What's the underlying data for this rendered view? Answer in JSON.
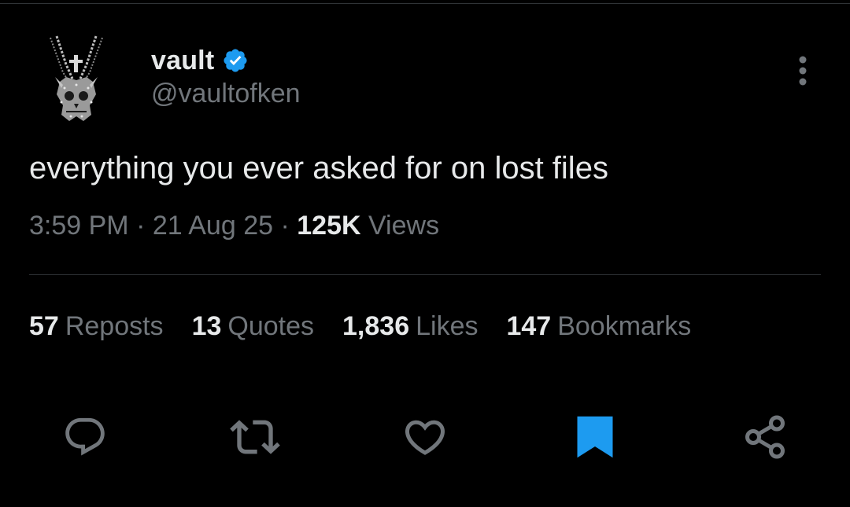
{
  "author": {
    "display_name": "vault",
    "handle": "@vaultofken",
    "verified_icon": "verified-badge-icon"
  },
  "tweet": {
    "text": "everything you ever asked for on lost files"
  },
  "meta": {
    "time": "3:59 PM",
    "separator_1": "·",
    "date": "21 Aug 25",
    "separator_2": "·",
    "views_count": "125K",
    "views_label": "Views"
  },
  "stats": [
    {
      "count": "57",
      "label": "Reposts"
    },
    {
      "count": "13",
      "label": "Quotes"
    },
    {
      "count": "1,836",
      "label": "Likes"
    },
    {
      "count": "147",
      "label": "Bookmarks"
    }
  ],
  "actions": [
    {
      "icon": "reply-icon"
    },
    {
      "icon": "repost-icon"
    },
    {
      "icon": "like-icon"
    },
    {
      "icon": "bookmark-icon",
      "active": true
    },
    {
      "icon": "share-icon"
    }
  ],
  "colors": {
    "background": "#000000",
    "text_primary": "#e7e9ea",
    "text_secondary": "#71767b",
    "accent": "#1d9bf0",
    "divider": "#2f3336"
  }
}
